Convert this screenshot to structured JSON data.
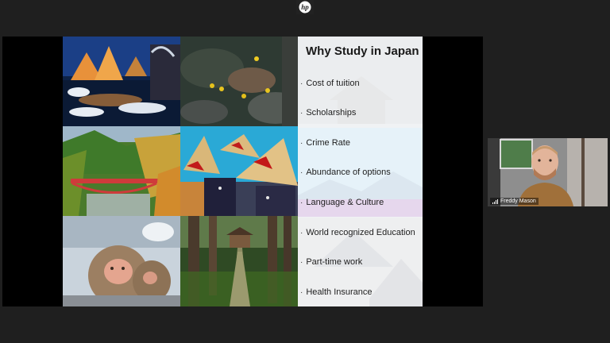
{
  "slide": {
    "title": "Why Study in Japan",
    "bullets": [
      "Cost of tuition",
      "Scholarships",
      "Crime Rate",
      "Abundance of options",
      "Language & Culture",
      "World recognized Education",
      "Part-time work",
      "Health Insurance"
    ],
    "bullet_glyph": "·"
  },
  "participant": {
    "name": "Freddy Mason"
  },
  "colors": {
    "background": "#1f1f1f",
    "share_background": "#000000"
  },
  "icons": {
    "top_logo": "hp-logo-icon",
    "network": "signal-bars-icon"
  }
}
